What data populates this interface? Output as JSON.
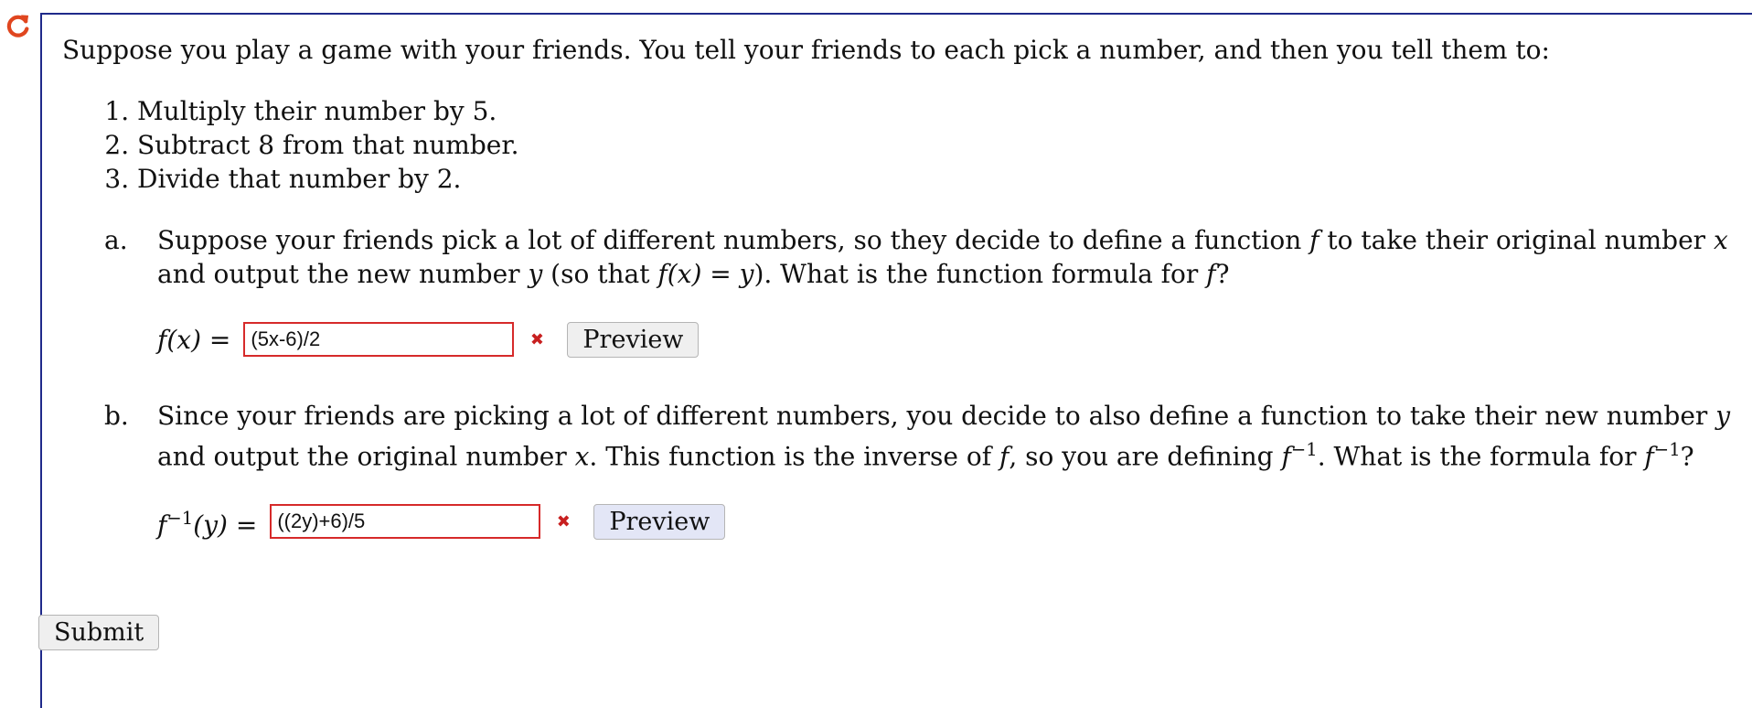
{
  "problem": {
    "intro": "Suppose you play a game with your friends. You tell your friends to each pick a number, and then you tell them to:",
    "steps": [
      "Multiply their number by 5.",
      "Subtract 8 from that number.",
      "Divide that number by 2."
    ]
  },
  "part_a": {
    "label": "a.",
    "text_1": "Suppose your friends pick a lot of different numbers, so they decide to define a function ",
    "var_f": "f",
    "text_2": " to take their original number ",
    "var_x": "x",
    "text_3": " and output the new number ",
    "var_y": "y",
    "text_4": " (so that ",
    "expr": "f(x) = y",
    "text_5": "). What is the function formula for ",
    "var_f2": "f",
    "text_6": "?",
    "lhs": "f(x)",
    "equals": " = ",
    "answer_value": "(5x-6)/2",
    "preview_label": "Preview"
  },
  "part_b": {
    "label": "b.",
    "text_1": "Since your friends are picking a lot of different numbers, you decide to also define a function to take their new number ",
    "var_y": "y",
    "text_2": " and output the original number ",
    "var_x": "x",
    "text_3": ". This function is the inverse of ",
    "var_f": "f",
    "text_4": ", so you are defining ",
    "var_f_inv": "f",
    "inv_exp": "−1",
    "text_5": ". What is the formula for ",
    "var_f_inv2": "f",
    "inv_exp2": "−1",
    "text_6": "?",
    "lhs_f": "f",
    "lhs_exp": "−1",
    "lhs_arg": "(y)",
    "equals": " = ",
    "answer_value": "((2y)+6)/5",
    "preview_label": "Preview"
  },
  "submit_label": "Submit",
  "colors": {
    "panel_border": "#1f2a8a",
    "error_border": "#d62a2a",
    "retry_icon": "#e0461f"
  }
}
